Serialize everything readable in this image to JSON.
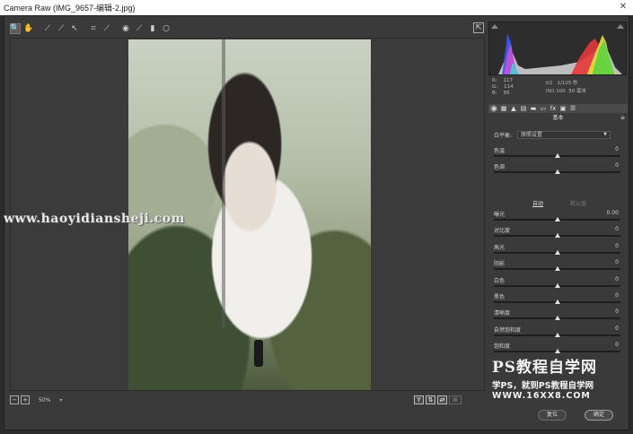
{
  "window": {
    "title": "Camera Raw (IMG_9657-编辑-2.jpg)"
  },
  "toolbar": {
    "tools": [
      {
        "icon": "zoom-icon",
        "glyph": "🔍",
        "active": true
      },
      {
        "icon": "hand-icon",
        "glyph": "✋",
        "active": false
      },
      {
        "icon": "white-balance-icon",
        "glyph": "⟋",
        "active": false
      },
      {
        "icon": "color-sampler-icon",
        "glyph": "⟋",
        "active": false
      },
      {
        "icon": "targeted-adjust-icon",
        "glyph": "↖",
        "active": false
      },
      {
        "icon": "crop-icon",
        "glyph": "⌗",
        "active": false
      },
      {
        "icon": "spot-removal-icon",
        "glyph": "⟋",
        "active": false
      },
      {
        "icon": "red-eye-icon",
        "glyph": "◉",
        "active": false
      },
      {
        "icon": "adjustment-brush-icon",
        "glyph": "⟋",
        "active": false
      },
      {
        "icon": "graduated-filter-icon",
        "glyph": "▮",
        "active": false
      },
      {
        "icon": "radial-filter-icon",
        "glyph": "○",
        "active": false
      }
    ]
  },
  "watermarks": {
    "url": "www.haoyidiansheji.com",
    "brand_line1": "PS教程自学网",
    "brand_line2": "学PS，就到PS教程自学网",
    "brand_line3": "WWW.16XX8.COM"
  },
  "statusbar": {
    "zoom": "50%"
  },
  "info": {
    "r_label": "R:",
    "r_value": "117",
    "g_label": "G:",
    "g_value": "114",
    "b_label": "B:",
    "b_value": "95",
    "aperture": "f/2",
    "shutter": "1/125 秒",
    "iso": "ISO 100",
    "focal": "50 毫米"
  },
  "histogram": {
    "colors": {
      "red": "#e5363a",
      "green": "#3fd23f",
      "blue": "#3a54e8",
      "yellow": "#e8e23c",
      "magenta": "#d34fd6",
      "cyan": "#3ed4d8",
      "white": "#d8d8d8"
    }
  },
  "panel": {
    "tabs": [
      {
        "icon": "basic-icon",
        "glyph": "◉",
        "active": true
      },
      {
        "icon": "tone-curve-icon",
        "glyph": "▦",
        "active": false
      },
      {
        "icon": "detail-icon",
        "glyph": "▲",
        "active": false
      },
      {
        "icon": "hsl-icon",
        "glyph": "▤",
        "active": false
      },
      {
        "icon": "split-toning-icon",
        "glyph": "▬",
        "active": false
      },
      {
        "icon": "lens-icon",
        "glyph": "▭",
        "active": false
      },
      {
        "icon": "effects-icon",
        "glyph": "fx",
        "active": false
      },
      {
        "icon": "camera-calibration-icon",
        "glyph": "▣",
        "active": false
      },
      {
        "icon": "presets-icon",
        "glyph": "☰",
        "active": false
      }
    ],
    "title": "基本",
    "wb_label": "白平衡:",
    "wb_value": "原照设置",
    "auto": "自动",
    "default": "默认值",
    "sliders_top": [
      {
        "label": "色温",
        "value": "0",
        "position": 0.5
      },
      {
        "label": "色调",
        "value": "0",
        "position": 0.5
      }
    ],
    "sliders_bottom": [
      {
        "label": "曝光",
        "value": "0.00",
        "position": 0.5
      },
      {
        "label": "对比度",
        "value": "0",
        "position": 0.5
      },
      {
        "label": "高光",
        "value": "0",
        "position": 0.5
      },
      {
        "label": "阴影",
        "value": "0",
        "position": 0.5
      },
      {
        "label": "白色",
        "value": "0",
        "position": 0.5
      },
      {
        "label": "黑色",
        "value": "0",
        "position": 0.5
      },
      {
        "label": "清晰度",
        "value": "0",
        "position": 0.5
      },
      {
        "label": "自然饱和度",
        "value": "0",
        "position": 0.5
      },
      {
        "label": "饱和度",
        "value": "0",
        "position": 0.5
      }
    ]
  },
  "buttons": {
    "reset": "复位",
    "ok": "确定"
  }
}
